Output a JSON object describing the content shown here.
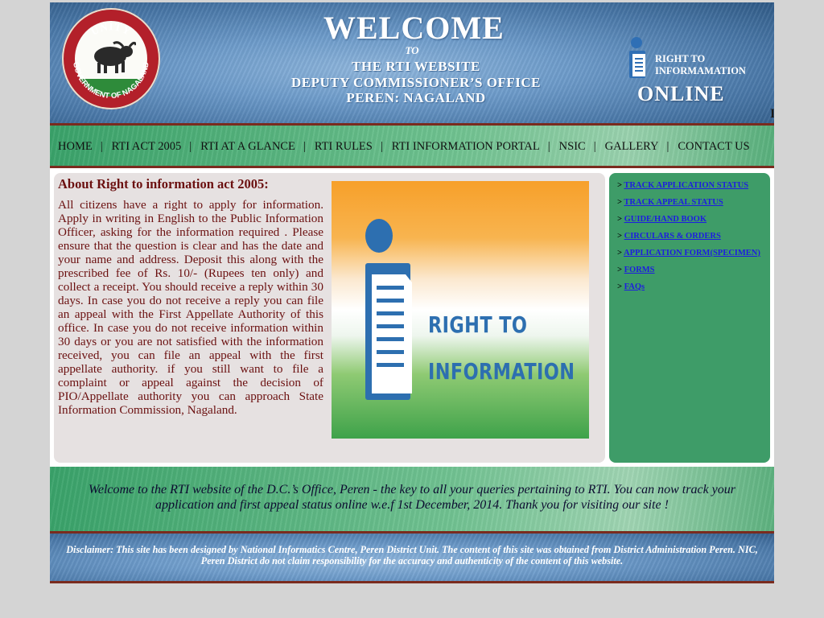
{
  "banner": {
    "seal_top_text": "UNITY",
    "seal_ring_text": "GOVERNMENT OF NAGALAND",
    "welcome": "WELCOME",
    "to": "TO",
    "line1": "THE RTI WEBSITE",
    "line2": "DEPUTY COMMISSIONER’S OFFICE",
    "line3": "PEREN: NAGALAND",
    "rti_logo_line1": "RIGHT TO",
    "rti_logo_line2": "INFORMAMATION",
    "rti_online": "ONLINE",
    "marquee_fragment": "I"
  },
  "nav": {
    "items": [
      "HOME",
      "RTI ACT 2005",
      "RTI AT A GLANCE",
      "RTI RULES",
      "RTI INFORMATION PORTAL",
      "NSIC",
      "GALLERY",
      "CONTACT US"
    ],
    "separator": "|"
  },
  "about": {
    "title": "About Right to information act 2005:",
    "body": "All citizens have a right to apply for information. Apply in writing in English to the Public Information Officer, asking for the information required . Please ensure that the question is clear and has the date and your name and address. Deposit this along with the prescribed fee of Rs. 10/- (Rupees ten only) and collect a receipt. You should receive a reply within 30 days. In case you do not receive a reply you can file an appeal with the First Appellate Authority of this office. In case you do not receive information within 30 days or you are not satisfied with the information received, you can file an appeal with the first appellate authority. if you still want to file a complaint or appeal against the decision of PIO/Appellate authority you can approach State Information Commission, Nagaland.",
    "image_line1": "RIGHT TO",
    "image_line2": "INFORMATION"
  },
  "sidebar": {
    "bullet": ">",
    "links": [
      "TRACK APPLICATION STATUS",
      "TRACK APPEAL STATUS",
      "GUIDE/HAND BOOK",
      "CIRCULARS & ORDERS",
      "APPLICATION FORM(SPECIMEN)",
      "FORMS",
      "FAQs"
    ]
  },
  "footer": {
    "welcome_message": "Welcome to the RTI website of the D.C.’s Office, Peren - the key to all your queries pertaining to RTI. You can now track your application and first appeal status online w.e.f 1st December, 2014. Thank you for visiting our site !",
    "disclaimer": "Disclaimer: This site has been designed by National Informatics Centre, Peren District Unit. The content of this site was obtained from District Administration Peren. NIC, Peren District do not claim responsibility for the accuracy and authenticity of the content of this website."
  },
  "colors": {
    "nav_green": "#3aa36a",
    "sidebar_green": "#3e9c68",
    "banner_blue": "#6d9bca",
    "maroon_text": "#6b1010",
    "link_blue": "#1d1de0",
    "divider": "#7a2b1e"
  }
}
